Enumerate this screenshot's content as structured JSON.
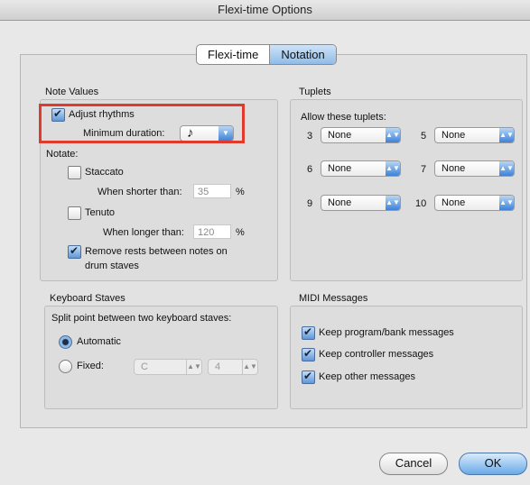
{
  "window": {
    "title": "Flexi-time Options"
  },
  "tabs": [
    {
      "label": "Flexi-time",
      "active": false
    },
    {
      "label": "Notation",
      "active": true
    }
  ],
  "note_values": {
    "title": "Note Values",
    "adjust_rhythms": {
      "label": "Adjust rhythms",
      "checked": true
    },
    "min_duration_label": "Minimum duration:",
    "min_duration_value": "♪",
    "notate_label": "Notate:",
    "staccato": {
      "label": "Staccato",
      "checked": false,
      "shorter_label": "When shorter than:",
      "value": "35",
      "unit": "%"
    },
    "tenuto": {
      "label": "Tenuto",
      "checked": false,
      "longer_label": "When longer than:",
      "value": "120",
      "unit": "%"
    },
    "remove_rests": {
      "label_line1": "Remove rests between notes on",
      "label_line2": "drum staves",
      "checked": true
    }
  },
  "tuplets": {
    "title": "Tuplets",
    "allow_label": "Allow these tuplets:",
    "items": [
      {
        "n": "3",
        "value": "None"
      },
      {
        "n": "5",
        "value": "None"
      },
      {
        "n": "6",
        "value": "None"
      },
      {
        "n": "7",
        "value": "None"
      },
      {
        "n": "9",
        "value": "None"
      },
      {
        "n": "10",
        "value": "None"
      }
    ]
  },
  "keyboard_staves": {
    "title": "Keyboard Staves",
    "split_label": "Split point between two keyboard staves:",
    "automatic": {
      "label": "Automatic",
      "selected": true
    },
    "fixed": {
      "label": "Fixed:",
      "selected": false,
      "note": "C",
      "octave": "4"
    }
  },
  "midi": {
    "title": "MIDI Messages",
    "items": [
      {
        "label": "Keep program/bank messages",
        "checked": true
      },
      {
        "label": "Keep controller messages",
        "checked": true
      },
      {
        "label": "Keep other messages",
        "checked": true
      }
    ]
  },
  "buttons": {
    "cancel": "Cancel",
    "ok": "OK"
  },
  "icons": {
    "popup_arrow": "up-down-arrows-icon",
    "dropdown_arrow": "chevron-down-icon"
  },
  "colors": {
    "highlight": "#e03a2d",
    "accent": "#3d82d7"
  }
}
